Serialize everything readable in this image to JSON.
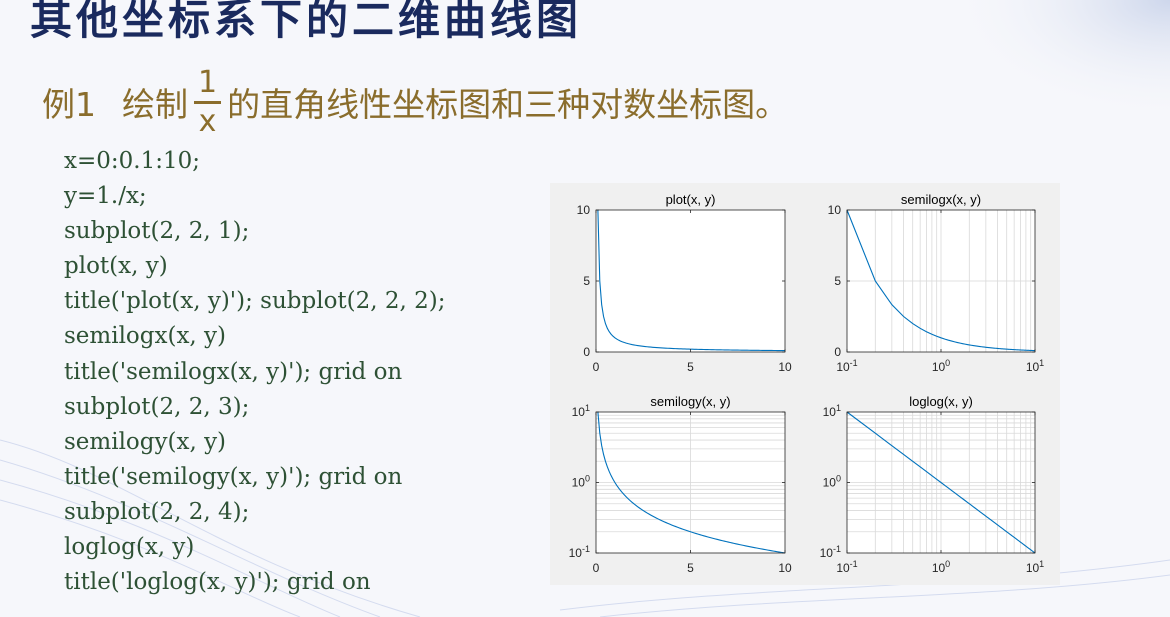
{
  "slide": {
    "title": "其他坐标系下的二维曲线图",
    "example_label": "例1",
    "task_prefix": "绘制",
    "fraction_numerator": "1",
    "fraction_denominator": "x",
    "task_suffix": "的直角线性坐标图和三种对数坐标图。"
  },
  "code_lines": [
    "x=0:0.1:10;",
    "y=1./x;",
    "subplot(2, 2, 1);",
    "plot(x, y)",
    "title('plot(x, y)'); subplot(2, 2, 2);",
    "semilogx(x, y)",
    "title('semilogx(x, y)'); grid on",
    "subplot(2, 2, 3);",
    "semilogy(x, y)",
    "title('semilogy(x, y)'); grid on",
    "subplot(2, 2, 4);",
    "loglog(x, y)",
    "title('loglog(x, y)'); grid on"
  ],
  "colors": {
    "title": "#1a2a5e",
    "example_text": "#8a6d2c",
    "code_text": "#2e5135",
    "line": "#0072bd",
    "grid": "#d9d9d9",
    "figure_bg": "#f0f0f0"
  },
  "chart_data": [
    {
      "type": "line",
      "title": "plot(x, y)",
      "x_scale": "linear",
      "y_scale": "linear",
      "xlim": [
        0,
        10
      ],
      "ylim": [
        0,
        10
      ],
      "x_ticks": [
        0,
        5,
        10
      ],
      "x_tick_labels": [
        "0",
        "5",
        "10"
      ],
      "y_ticks": [
        0,
        5,
        10
      ],
      "y_tick_labels": [
        "0",
        "5",
        "10"
      ],
      "grid": false,
      "series": [
        {
          "function": "y = 1/x",
          "x_start": 0,
          "x_step": 0.1,
          "x_end": 10
        }
      ]
    },
    {
      "type": "line",
      "title": "semilogx(x, y)",
      "x_scale": "log",
      "y_scale": "linear",
      "xlim": [
        0.1,
        10
      ],
      "ylim": [
        0,
        10
      ],
      "x_ticks": [
        0.1,
        1,
        10
      ],
      "x_tick_labels": [
        {
          "base": "10",
          "exp": "-1"
        },
        {
          "base": "10",
          "exp": "0"
        },
        {
          "base": "10",
          "exp": "1"
        }
      ],
      "y_ticks": [
        0,
        5,
        10
      ],
      "y_tick_labels": [
        "0",
        "5",
        "10"
      ],
      "grid": true,
      "series": [
        {
          "function": "y = 1/x",
          "x_start": 0,
          "x_step": 0.1,
          "x_end": 10
        }
      ]
    },
    {
      "type": "line",
      "title": "semilogy(x, y)",
      "x_scale": "linear",
      "y_scale": "log",
      "xlim": [
        0,
        10
      ],
      "ylim": [
        0.1,
        10
      ],
      "x_ticks": [
        0,
        5,
        10
      ],
      "x_tick_labels": [
        "0",
        "5",
        "10"
      ],
      "y_ticks": [
        0.1,
        1,
        10
      ],
      "y_tick_labels": [
        {
          "base": "10",
          "exp": "-1"
        },
        {
          "base": "10",
          "exp": "0"
        },
        {
          "base": "10",
          "exp": "1"
        }
      ],
      "grid": true,
      "series": [
        {
          "function": "y = 1/x",
          "x_start": 0,
          "x_step": 0.1,
          "x_end": 10
        }
      ]
    },
    {
      "type": "line",
      "title": "loglog(x, y)",
      "x_scale": "log",
      "y_scale": "log",
      "xlim": [
        0.1,
        10
      ],
      "ylim": [
        0.1,
        10
      ],
      "x_ticks": [
        0.1,
        1,
        10
      ],
      "x_tick_labels": [
        {
          "base": "10",
          "exp": "-1"
        },
        {
          "base": "10",
          "exp": "0"
        },
        {
          "base": "10",
          "exp": "1"
        }
      ],
      "y_ticks": [
        0.1,
        1,
        10
      ],
      "y_tick_labels": [
        {
          "base": "10",
          "exp": "-1"
        },
        {
          "base": "10",
          "exp": "0"
        },
        {
          "base": "10",
          "exp": "1"
        }
      ],
      "grid": true,
      "series": [
        {
          "function": "y = 1/x",
          "x_start": 0,
          "x_step": 0.1,
          "x_end": 10
        }
      ]
    }
  ]
}
